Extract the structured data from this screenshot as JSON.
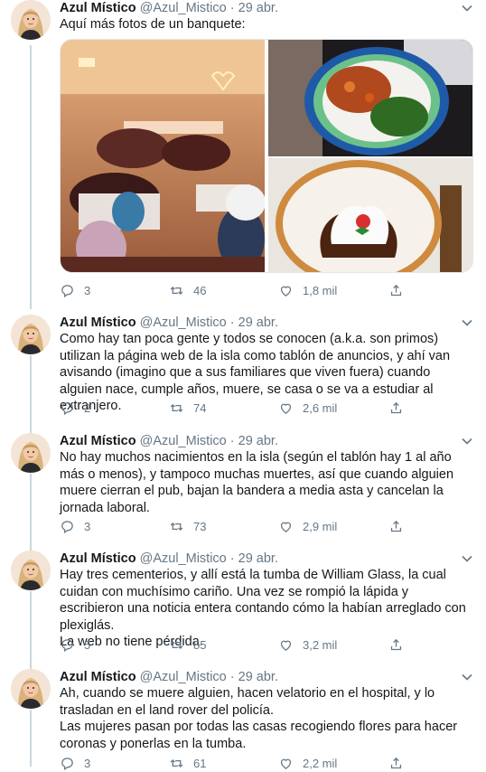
{
  "tweets": [
    {
      "author": "Azul Místico",
      "handle": "@Azul_Mistico",
      "sep": "·",
      "date": "29 abr.",
      "text": "Aquí más fotos de un banquete:",
      "replies": "3",
      "retweets": "46",
      "likes": "1,8 mil",
      "has_media": true
    },
    {
      "author": "Azul Místico",
      "handle": "@Azul_Mistico",
      "sep": "·",
      "date": "29 abr.",
      "text": "Como hay tan poca gente y todos se conocen (a.k.a. son primos) utilizan la página web de la isla como tablón de anuncios, y ahí van avisando (imagino que a sus familiares que viven fuera) cuando alguien nace, cumple años, muere, se casa o se va a estudiar al extranjero.",
      "replies": "2",
      "retweets": "74",
      "likes": "2,6 mil"
    },
    {
      "author": "Azul Místico",
      "handle": "@Azul_Mistico",
      "sep": "·",
      "date": "29 abr.",
      "text": "No hay muchos nacimientos en la isla (según el tablón hay 1 al año más o menos), y tampoco muchas muertes, así que cuando alguien muere cierran el pub, bajan la bandera a media asta y cancelan la jornada laboral.",
      "replies": "3",
      "retweets": "73",
      "likes": "2,9 mil"
    },
    {
      "author": "Azul Místico",
      "handle": "@Azul_Mistico",
      "sep": "·",
      "date": "29 abr.",
      "text": "Hay tres cementerios, y allí está la tumba de William Glass, la cual cuidan con muchísimo cariño. Una vez se rompió la lápida y escribieron una noticia entera contando cómo la habían arreglado con plexiglás.\nLa web no tiene pérdida.",
      "replies": "5",
      "retweets": "85",
      "likes": "3,2 mil"
    },
    {
      "author": "Azul Místico",
      "handle": "@Azul_Mistico",
      "sep": "·",
      "date": "29 abr.",
      "text": "Ah, cuando se muere alguien, hacen velatorio en el hospital, y lo trasladan en el land rover del policía.\nLas mujeres pasan por todas las casas recogiendo flores para hacer coronas y ponerlas en la tumba.",
      "replies": "3",
      "retweets": "61",
      "likes": "2,2 mil"
    }
  ],
  "icons": {
    "reply": "reply-icon",
    "retweet": "retweet-icon",
    "like": "heart-icon",
    "share": "share-icon",
    "more": "chevron-down-icon"
  },
  "colors": {
    "text": "#14171a",
    "secondary": "#657786",
    "thread_line": "#ccd6dd"
  }
}
